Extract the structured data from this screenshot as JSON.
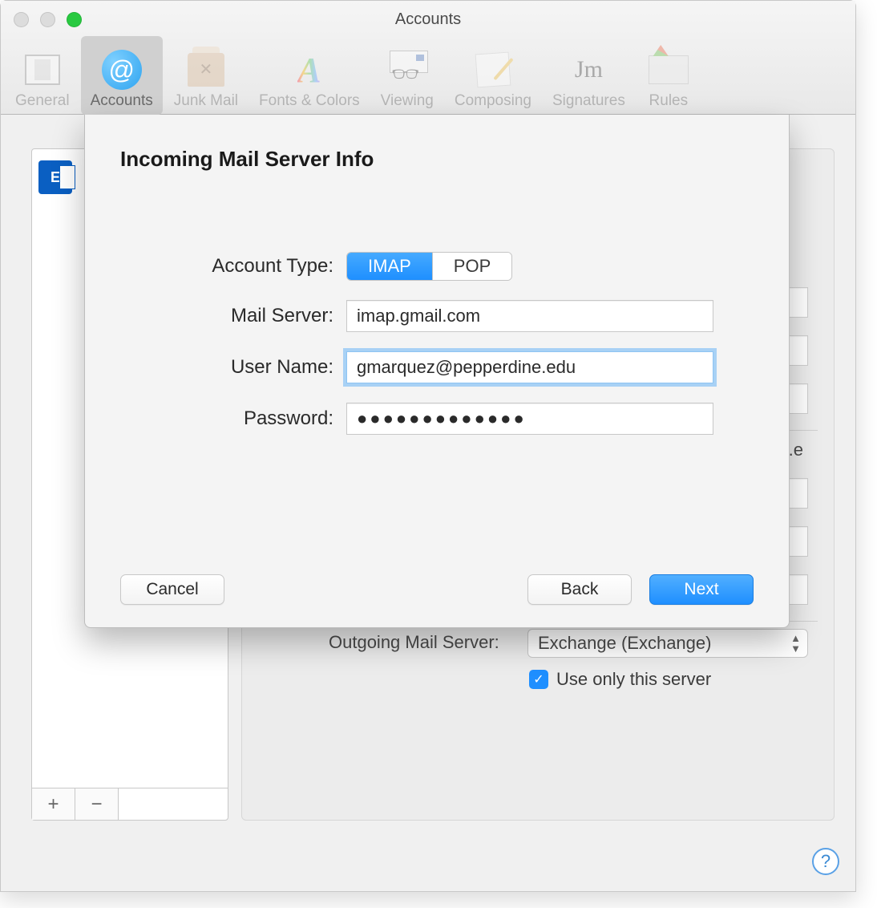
{
  "window": {
    "title": "Accounts"
  },
  "toolbar": {
    "items": [
      {
        "label": "General"
      },
      {
        "label": "Accounts"
      },
      {
        "label": "Junk Mail"
      },
      {
        "label": "Fonts & Colors"
      },
      {
        "label": "Viewing"
      },
      {
        "label": "Composing"
      },
      {
        "label": "Signatures"
      },
      {
        "label": "Rules"
      }
    ]
  },
  "sidebar": {
    "add_glyph": "+",
    "remove_glyph": "−"
  },
  "background_panel": {
    "outgoing_label": "Outgoing Mail Server:",
    "outgoing_value": "Exchange (Exchange)",
    "checkbox_label": "Use only this server",
    "truncated_text": "e.e"
  },
  "sheet": {
    "title": "Incoming Mail Server Info",
    "labels": {
      "account_type": "Account Type:",
      "mail_server": "Mail Server:",
      "user_name": "User Name:",
      "password": "Password:"
    },
    "segmented": {
      "imap": "IMAP",
      "pop": "POP",
      "selected": "IMAP"
    },
    "values": {
      "mail_server": "imap.gmail.com",
      "user_name": "gmarquez@pepperdine.edu",
      "password_mask": "●●●●●●●●●●●●●"
    },
    "buttons": {
      "cancel": "Cancel",
      "back": "Back",
      "next": "Next"
    }
  },
  "help": {
    "glyph": "?"
  }
}
